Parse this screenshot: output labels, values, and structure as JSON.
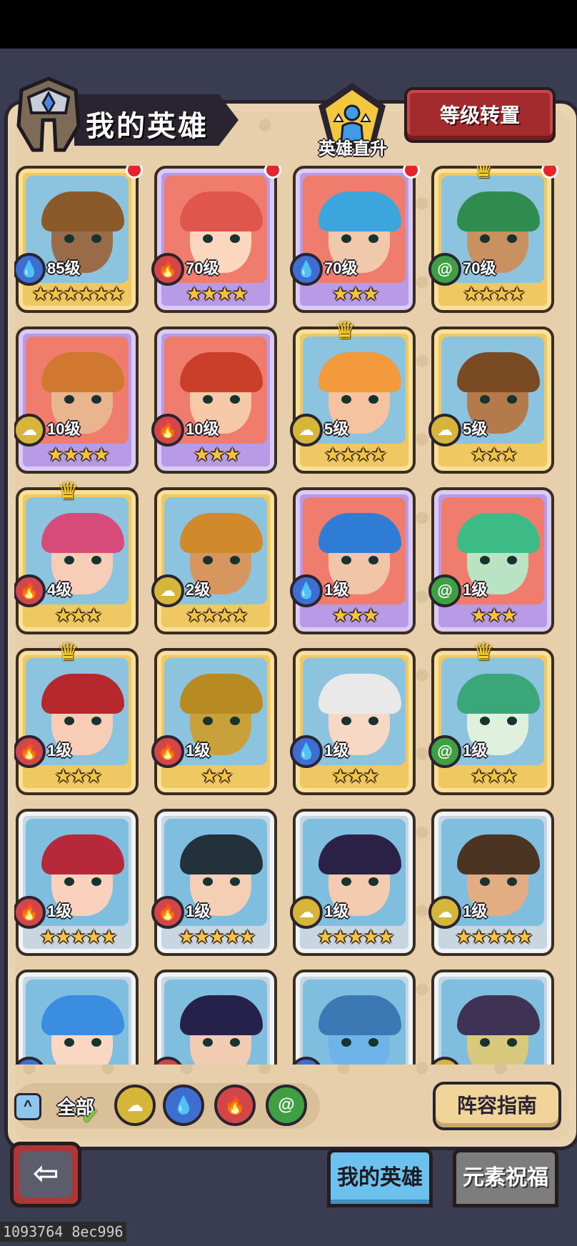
{
  "header": {
    "title": "我的英雄",
    "promote_label": "英雄直升",
    "reset_button": "等级转置"
  },
  "colors": {
    "water": "#3e6fd0",
    "fire": "#d2464a",
    "wind": "#3ea043",
    "earth": "#d5b53a",
    "gold_frame": "#f0c862",
    "purple_frame": "#b89ae6",
    "silver_frame": "#c8d6e2"
  },
  "heroes": [
    {
      "level": "85级",
      "stars": 6,
      "element": "water",
      "rarity": "gold",
      "red_dot": true,
      "crown": false
    },
    {
      "level": "70级",
      "stars": 4,
      "element": "fire",
      "rarity": "purple",
      "red_dot": true,
      "crown": false
    },
    {
      "level": "70级",
      "stars": 3,
      "element": "water",
      "rarity": "purple",
      "red_dot": true,
      "crown": false
    },
    {
      "level": "70级",
      "stars": 4,
      "element": "wind",
      "rarity": "gold",
      "red_dot": true,
      "crown": true
    },
    {
      "level": "10级",
      "stars": 4,
      "element": "earth",
      "rarity": "purple",
      "red_dot": false,
      "crown": false
    },
    {
      "level": "10级",
      "stars": 3,
      "element": "fire",
      "rarity": "purple",
      "red_dot": false,
      "crown": false
    },
    {
      "level": "5级",
      "stars": 4,
      "element": "earth",
      "rarity": "gold",
      "red_dot": false,
      "crown": true
    },
    {
      "level": "5级",
      "stars": 3,
      "element": "earth",
      "rarity": "gold",
      "red_dot": false,
      "crown": false
    },
    {
      "level": "4级",
      "stars": 3,
      "element": "fire",
      "rarity": "gold",
      "red_dot": false,
      "crown": true
    },
    {
      "level": "2级",
      "stars": 4,
      "element": "earth",
      "rarity": "gold",
      "red_dot": false,
      "crown": false
    },
    {
      "level": "1级",
      "stars": 3,
      "element": "water",
      "rarity": "purple",
      "red_dot": false,
      "crown": false
    },
    {
      "level": "1级",
      "stars": 3,
      "element": "wind",
      "rarity": "purple",
      "red_dot": false,
      "crown": false
    },
    {
      "level": "1级",
      "stars": 3,
      "element": "fire",
      "rarity": "gold",
      "red_dot": false,
      "crown": true
    },
    {
      "level": "1级",
      "stars": 2,
      "element": "fire",
      "rarity": "gold",
      "red_dot": false,
      "crown": false
    },
    {
      "level": "1级",
      "stars": 3,
      "element": "water",
      "rarity": "gold",
      "red_dot": false,
      "crown": false
    },
    {
      "level": "1级",
      "stars": 3,
      "element": "wind",
      "rarity": "gold",
      "red_dot": false,
      "crown": true
    },
    {
      "level": "1级",
      "stars": 5,
      "element": "fire",
      "rarity": "silver",
      "red_dot": false,
      "crown": false
    },
    {
      "level": "1级",
      "stars": 5,
      "element": "fire",
      "rarity": "silver",
      "red_dot": false,
      "crown": false
    },
    {
      "level": "1级",
      "stars": 5,
      "element": "earth",
      "rarity": "silver",
      "red_dot": false,
      "crown": false
    },
    {
      "level": "1级",
      "stars": 5,
      "element": "earth",
      "rarity": "silver",
      "red_dot": false,
      "crown": false
    },
    {
      "level": "",
      "stars": 0,
      "element": "water",
      "rarity": "silver",
      "red_dot": false,
      "crown": false
    },
    {
      "level": "",
      "stars": 0,
      "element": "fire",
      "rarity": "silver",
      "red_dot": false,
      "crown": false
    },
    {
      "level": "",
      "stars": 0,
      "element": "water",
      "rarity": "silver",
      "red_dot": false,
      "crown": false
    },
    {
      "level": "",
      "stars": 0,
      "element": "earth",
      "rarity": "silver",
      "red_dot": false,
      "crown": false
    }
  ],
  "filter": {
    "collapse_icon": "chevron-up-icon",
    "all_label": "全部",
    "all_selected": true,
    "elements": [
      "earth",
      "water",
      "fire",
      "wind"
    ]
  },
  "guide_button": "阵容指南",
  "tabs": {
    "my_heroes": "我的英雄",
    "element_blessing": "元素祝福"
  },
  "footer_id": "1093764 8ec996"
}
